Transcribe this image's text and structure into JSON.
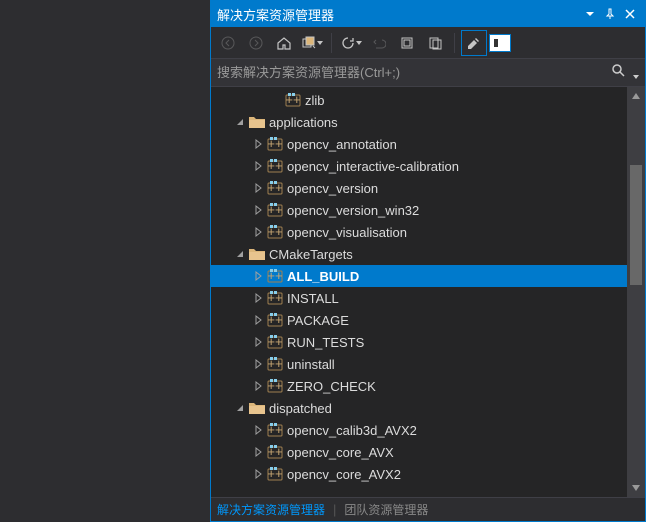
{
  "titlebar": {
    "title": "解决方案资源管理器"
  },
  "search": {
    "placeholder": "搜索解决方案资源管理器(Ctrl+;)"
  },
  "tree": {
    "nodes": [
      {
        "depth": 3,
        "exp": "none",
        "icon": "cpp",
        "label": "zlib"
      },
      {
        "depth": 1,
        "exp": "open",
        "icon": "folder",
        "label": "applications"
      },
      {
        "depth": 2,
        "exp": "closed",
        "icon": "cpp",
        "label": "opencv_annotation"
      },
      {
        "depth": 2,
        "exp": "closed",
        "icon": "cpp",
        "label": "opencv_interactive-calibration"
      },
      {
        "depth": 2,
        "exp": "closed",
        "icon": "cpp",
        "label": "opencv_version"
      },
      {
        "depth": 2,
        "exp": "closed",
        "icon": "cpp",
        "label": "opencv_version_win32"
      },
      {
        "depth": 2,
        "exp": "closed",
        "icon": "cpp",
        "label": "opencv_visualisation"
      },
      {
        "depth": 1,
        "exp": "open",
        "icon": "folder",
        "label": "CMakeTargets"
      },
      {
        "depth": 2,
        "exp": "closed",
        "icon": "cpp",
        "label": "ALL_BUILD",
        "selected": true
      },
      {
        "depth": 2,
        "exp": "closed",
        "icon": "cpp",
        "label": "INSTALL"
      },
      {
        "depth": 2,
        "exp": "closed",
        "icon": "cpp",
        "label": "PACKAGE"
      },
      {
        "depth": 2,
        "exp": "closed",
        "icon": "cpp",
        "label": "RUN_TESTS"
      },
      {
        "depth": 2,
        "exp": "closed",
        "icon": "cpp",
        "label": "uninstall"
      },
      {
        "depth": 2,
        "exp": "closed",
        "icon": "cpp",
        "label": "ZERO_CHECK"
      },
      {
        "depth": 1,
        "exp": "open",
        "icon": "folder",
        "label": "dispatched"
      },
      {
        "depth": 2,
        "exp": "closed",
        "icon": "cpp",
        "label": "opencv_calib3d_AVX2"
      },
      {
        "depth": 2,
        "exp": "closed",
        "icon": "cpp",
        "label": "opencv_core_AVX"
      },
      {
        "depth": 2,
        "exp": "closed",
        "icon": "cpp",
        "label": "opencv_core_AVX2"
      }
    ]
  },
  "tabs": {
    "active": "解决方案资源管理器",
    "inactive": "团队资源管理器"
  }
}
